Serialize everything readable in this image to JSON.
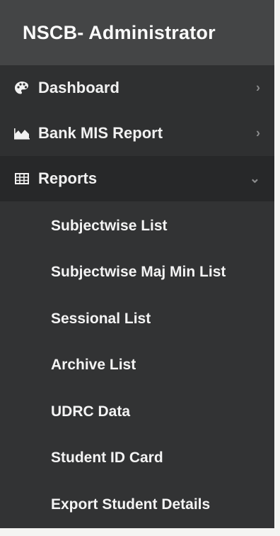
{
  "brand": {
    "title": "NSCB- Administrator"
  },
  "menu": [
    {
      "label": "Dashboard",
      "icon": "palette-icon",
      "chevron": "›"
    },
    {
      "label": "Bank MIS Report",
      "icon": "area-chart-icon",
      "chevron": "›"
    },
    {
      "label": "Reports",
      "icon": "table-icon",
      "chevron": "⌄",
      "expanded": true
    }
  ],
  "submenu": [
    {
      "label": "Subjectwise List"
    },
    {
      "label": "Subjectwise Maj Min List"
    },
    {
      "label": "Sessional List"
    },
    {
      "label": "Archive List"
    },
    {
      "label": "UDRC Data"
    },
    {
      "label": "Student ID Card"
    },
    {
      "label": "Export Student Details"
    }
  ],
  "colors": {
    "sidebar_bg": "#2c2d2e",
    "brand_bg": "#444546",
    "text": "#f1f1f1"
  }
}
